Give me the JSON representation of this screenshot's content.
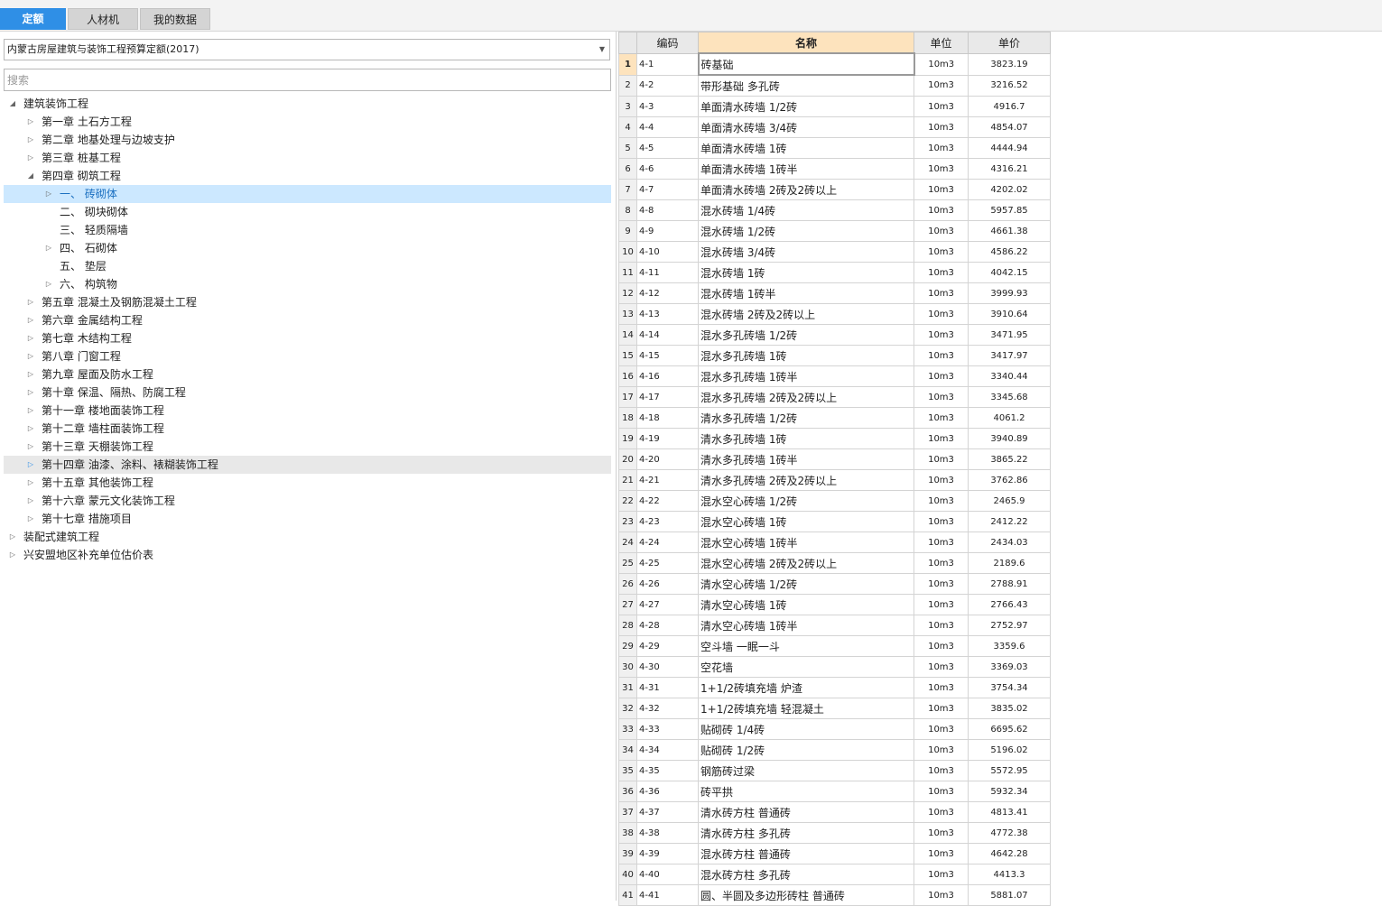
{
  "tabs": [
    "定额",
    "人材机",
    "我的数据"
  ],
  "quota_select": {
    "value": "内蒙古房屋建筑与装饰工程预算定额(2017)"
  },
  "search": {
    "placeholder": "搜索"
  },
  "tree": [
    {
      "label": "建筑装饰工程",
      "level": 0,
      "state": "expanded"
    },
    {
      "label": "第一章 土石方工程",
      "level": 1,
      "state": "collapsed"
    },
    {
      "label": "第二章 地基处理与边坡支护",
      "level": 1,
      "state": "collapsed"
    },
    {
      "label": "第三章 桩基工程",
      "level": 1,
      "state": "collapsed"
    },
    {
      "label": "第四章 砌筑工程",
      "level": 1,
      "state": "expanded"
    },
    {
      "label": "一、 砖砌体",
      "level": 2,
      "state": "collapsed",
      "selected": true
    },
    {
      "label": "二、 砌块砌体",
      "level": 2,
      "state": "leaf"
    },
    {
      "label": "三、 轻质隔墙",
      "level": 2,
      "state": "leaf"
    },
    {
      "label": "四、 石砌体",
      "level": 2,
      "state": "collapsed"
    },
    {
      "label": "五、 垫层",
      "level": 2,
      "state": "leaf"
    },
    {
      "label": "六、 构筑物",
      "level": 2,
      "state": "collapsed"
    },
    {
      "label": "第五章 混凝土及钢筋混凝土工程",
      "level": 1,
      "state": "collapsed"
    },
    {
      "label": "第六章 金属结构工程",
      "level": 1,
      "state": "collapsed"
    },
    {
      "label": "第七章 木结构工程",
      "level": 1,
      "state": "collapsed"
    },
    {
      "label": "第八章 门窗工程",
      "level": 1,
      "state": "collapsed"
    },
    {
      "label": "第九章 屋面及防水工程",
      "level": 1,
      "state": "collapsed"
    },
    {
      "label": "第十章 保温、隔热、防腐工程",
      "level": 1,
      "state": "collapsed"
    },
    {
      "label": "第十一章 楼地面装饰工程",
      "level": 1,
      "state": "collapsed"
    },
    {
      "label": "第十二章 墙柱面装饰工程",
      "level": 1,
      "state": "collapsed"
    },
    {
      "label": "第十三章 天棚装饰工程",
      "level": 1,
      "state": "collapsed"
    },
    {
      "label": "第十四章 油漆、涂料、裱糊装饰工程",
      "level": 1,
      "state": "collapsed",
      "hover": true
    },
    {
      "label": "第十五章 其他装饰工程",
      "level": 1,
      "state": "collapsed"
    },
    {
      "label": "第十六章 蒙元文化装饰工程",
      "level": 1,
      "state": "collapsed"
    },
    {
      "label": "第十七章 措施项目",
      "level": 1,
      "state": "collapsed"
    },
    {
      "label": "装配式建筑工程",
      "level": 0,
      "state": "collapsed"
    },
    {
      "label": "兴安盟地区补充单位估价表",
      "level": 0,
      "state": "collapsed"
    }
  ],
  "table": {
    "headers": [
      "编码",
      "名称",
      "单位",
      "单价"
    ],
    "rows": [
      [
        "1",
        "4-1",
        "砖基础",
        "10m3",
        "3823.19"
      ],
      [
        "2",
        "4-2",
        "带形基础 多孔砖",
        "10m3",
        "3216.52"
      ],
      [
        "3",
        "4-3",
        "单面清水砖墙 1/2砖",
        "10m3",
        "4916.7"
      ],
      [
        "4",
        "4-4",
        "单面清水砖墙 3/4砖",
        "10m3",
        "4854.07"
      ],
      [
        "5",
        "4-5",
        "单面清水砖墙 1砖",
        "10m3",
        "4444.94"
      ],
      [
        "6",
        "4-6",
        "单面清水砖墙 1砖半",
        "10m3",
        "4316.21"
      ],
      [
        "7",
        "4-7",
        "单面清水砖墙 2砖及2砖以上",
        "10m3",
        "4202.02"
      ],
      [
        "8",
        "4-8",
        "混水砖墙 1/4砖",
        "10m3",
        "5957.85"
      ],
      [
        "9",
        "4-9",
        "混水砖墙 1/2砖",
        "10m3",
        "4661.38"
      ],
      [
        "10",
        "4-10",
        "混水砖墙 3/4砖",
        "10m3",
        "4586.22"
      ],
      [
        "11",
        "4-11",
        "混水砖墙 1砖",
        "10m3",
        "4042.15"
      ],
      [
        "12",
        "4-12",
        "混水砖墙 1砖半",
        "10m3",
        "3999.93"
      ],
      [
        "13",
        "4-13",
        "混水砖墙 2砖及2砖以上",
        "10m3",
        "3910.64"
      ],
      [
        "14",
        "4-14",
        "混水多孔砖墙 1/2砖",
        "10m3",
        "3471.95"
      ],
      [
        "15",
        "4-15",
        "混水多孔砖墙 1砖",
        "10m3",
        "3417.97"
      ],
      [
        "16",
        "4-16",
        "混水多孔砖墙 1砖半",
        "10m3",
        "3340.44"
      ],
      [
        "17",
        "4-17",
        "混水多孔砖墙 2砖及2砖以上",
        "10m3",
        "3345.68"
      ],
      [
        "18",
        "4-18",
        "清水多孔砖墙 1/2砖",
        "10m3",
        "4061.2"
      ],
      [
        "19",
        "4-19",
        "清水多孔砖墙 1砖",
        "10m3",
        "3940.89"
      ],
      [
        "20",
        "4-20",
        "清水多孔砖墙 1砖半",
        "10m3",
        "3865.22"
      ],
      [
        "21",
        "4-21",
        "清水多孔砖墙 2砖及2砖以上",
        "10m3",
        "3762.86"
      ],
      [
        "22",
        "4-22",
        "混水空心砖墙 1/2砖",
        "10m3",
        "2465.9"
      ],
      [
        "23",
        "4-23",
        "混水空心砖墙 1砖",
        "10m3",
        "2412.22"
      ],
      [
        "24",
        "4-24",
        "混水空心砖墙 1砖半",
        "10m3",
        "2434.03"
      ],
      [
        "25",
        "4-25",
        "混水空心砖墙 2砖及2砖以上",
        "10m3",
        "2189.6"
      ],
      [
        "26",
        "4-26",
        "清水空心砖墙 1/2砖",
        "10m3",
        "2788.91"
      ],
      [
        "27",
        "4-27",
        "清水空心砖墙 1砖",
        "10m3",
        "2766.43"
      ],
      [
        "28",
        "4-28",
        "清水空心砖墙 1砖半",
        "10m3",
        "2752.97"
      ],
      [
        "29",
        "4-29",
        "空斗墙 一眠一斗",
        "10m3",
        "3359.6"
      ],
      [
        "30",
        "4-30",
        "空花墙",
        "10m3",
        "3369.03"
      ],
      [
        "31",
        "4-31",
        "1+1/2砖填充墙 炉渣",
        "10m3",
        "3754.34"
      ],
      [
        "32",
        "4-32",
        "1+1/2砖填充墙 轻混凝土",
        "10m3",
        "3835.02"
      ],
      [
        "33",
        "4-33",
        "贴砌砖 1/4砖",
        "10m3",
        "6695.62"
      ],
      [
        "34",
        "4-34",
        "贴砌砖 1/2砖",
        "10m3",
        "5196.02"
      ],
      [
        "35",
        "4-35",
        "钢筋砖过梁",
        "10m3",
        "5572.95"
      ],
      [
        "36",
        "4-36",
        "砖平拱",
        "10m3",
        "5932.34"
      ],
      [
        "37",
        "4-37",
        "清水砖方柱 普通砖",
        "10m3",
        "4813.41"
      ],
      [
        "38",
        "4-38",
        "清水砖方柱 多孔砖",
        "10m3",
        "4772.38"
      ],
      [
        "39",
        "4-39",
        "混水砖方柱 普通砖",
        "10m3",
        "4642.28"
      ],
      [
        "40",
        "4-40",
        "混水砖方柱 多孔砖",
        "10m3",
        "4413.3"
      ],
      [
        "41",
        "4-41",
        "圆、半圆及多边形砖柱 普通砖",
        "10m3",
        "5881.07"
      ]
    ]
  }
}
